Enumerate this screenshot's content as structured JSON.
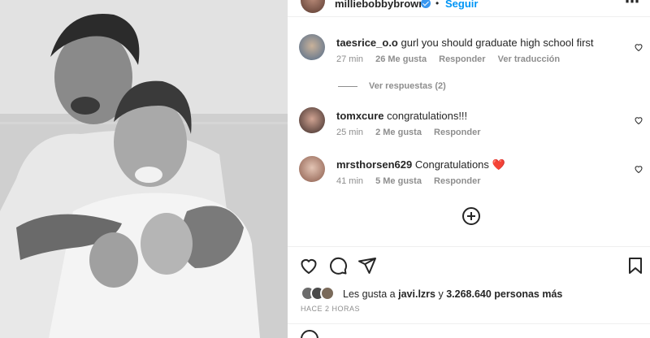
{
  "post": {
    "author": "milliebobbybrown",
    "dot": "•",
    "follow_label": "Seguir",
    "more_label": "⋯"
  },
  "comments": [
    {
      "username": "taesrice_o.o",
      "text": "gurl you should graduate high school first",
      "time": "27 min",
      "likes": "26 Me gusta",
      "reply": "Responder",
      "translate": "Ver traducción"
    },
    {
      "username": "tomxcure",
      "text": "congratulations!!!",
      "time": "25 min",
      "likes": "2 Me gusta",
      "reply": "Responder"
    },
    {
      "username": "mrsthorsen629",
      "text": "Congratulations",
      "emoji": "❤️",
      "time": "41 min",
      "likes": "5 Me gusta",
      "reply": "Responder"
    }
  ],
  "view_replies": "Ver respuestas (2)",
  "likes": {
    "prefix": "Les gusta a",
    "user": "javi.lzrs",
    "connector": "y",
    "count": "3.268.640 personas más"
  },
  "timestamp": "HACE 2 HORAS",
  "icons": {
    "verified": "verified-badge-icon",
    "heart": "heart-icon",
    "comment": "comment-icon",
    "share": "share-icon",
    "save": "bookmark-icon",
    "more_comments": "plus-circle-icon",
    "more": "more-options-icon"
  },
  "colors": {
    "accent": "#0095f6",
    "verified": "#3897f0",
    "heart_red": "#ed4956",
    "muted": "#8e8e8e",
    "text": "#262626"
  }
}
